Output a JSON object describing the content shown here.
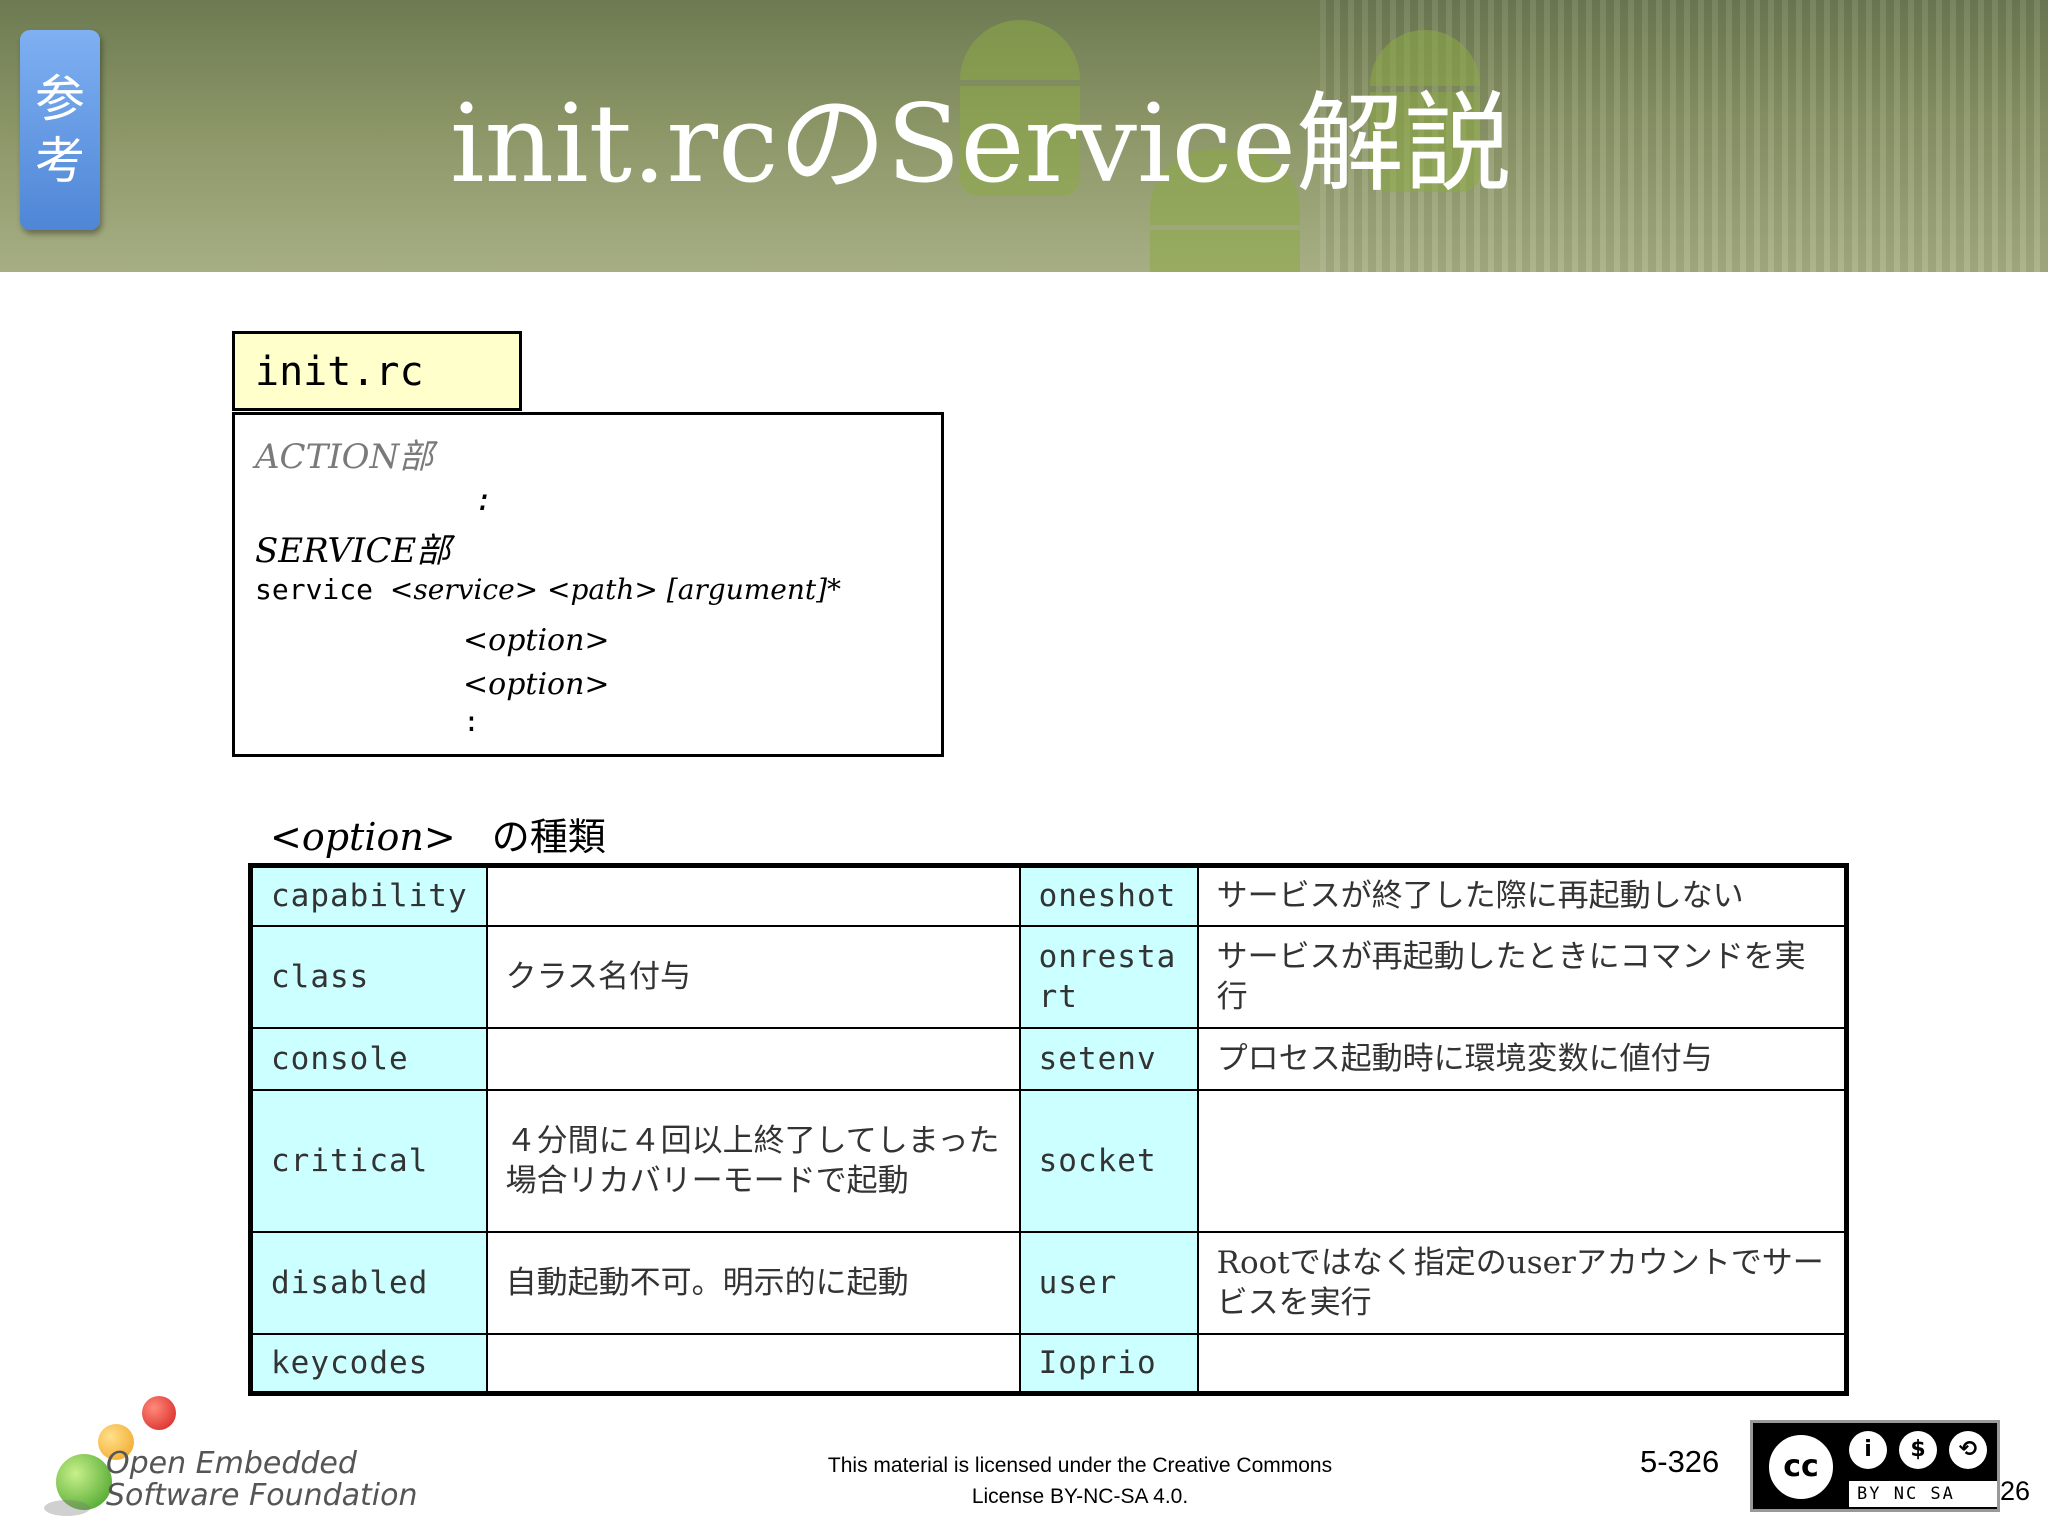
{
  "slide": {
    "ref_tab": "参考",
    "title": "init.rcのService解説"
  },
  "code_box": {
    "filename": "init.rc",
    "action_section": "ACTION部",
    "ellipsis1": ":",
    "service_section": "SERVICE部",
    "service_keyword": "service",
    "service_args": "<service> <path> [argument]*",
    "option1": "<option>",
    "option2": "<option>",
    "ellipsis2": ":"
  },
  "options_heading": {
    "tag": "<option>",
    "label": "の種類"
  },
  "options_table": [
    {
      "k1": "capability",
      "v1": "",
      "k2": "oneshot",
      "v2": "サービスが終了した際に再起動しない"
    },
    {
      "k1": "class",
      "v1": "クラス名付与",
      "k2": "onresta\nrt",
      "v2": "サービスが再起動したときにコマンドを実行"
    },
    {
      "k1": "console",
      "v1": "",
      "k2": "setenv",
      "v2": "プロセス起動時に環境変数に値付与"
    },
    {
      "k1": "critical",
      "v1": "４分間に４回以上終了してしまった場合リカバリーモードで起動",
      "k2": "socket",
      "v2": ""
    },
    {
      "k1": "disabled",
      "v1": "自動起動不可。明示的に起動",
      "k2": "user",
      "v2": "Rootではなく指定のuserアカウントでサービスを実行"
    },
    {
      "k1": "keycodes",
      "v1": "",
      "k2": "Ioprio",
      "v2": ""
    }
  ],
  "footer": {
    "logo_line1": "Open Embedded",
    "logo_line2": "Software Foundation",
    "license_line1": "This material is licensed under the Creative Commons",
    "license_line2": "License BY-NC-SA 4.0.",
    "page_number": "5-326",
    "page_number_small": "26",
    "cc_label": "cc",
    "cc_tags": "BY NC SA"
  }
}
